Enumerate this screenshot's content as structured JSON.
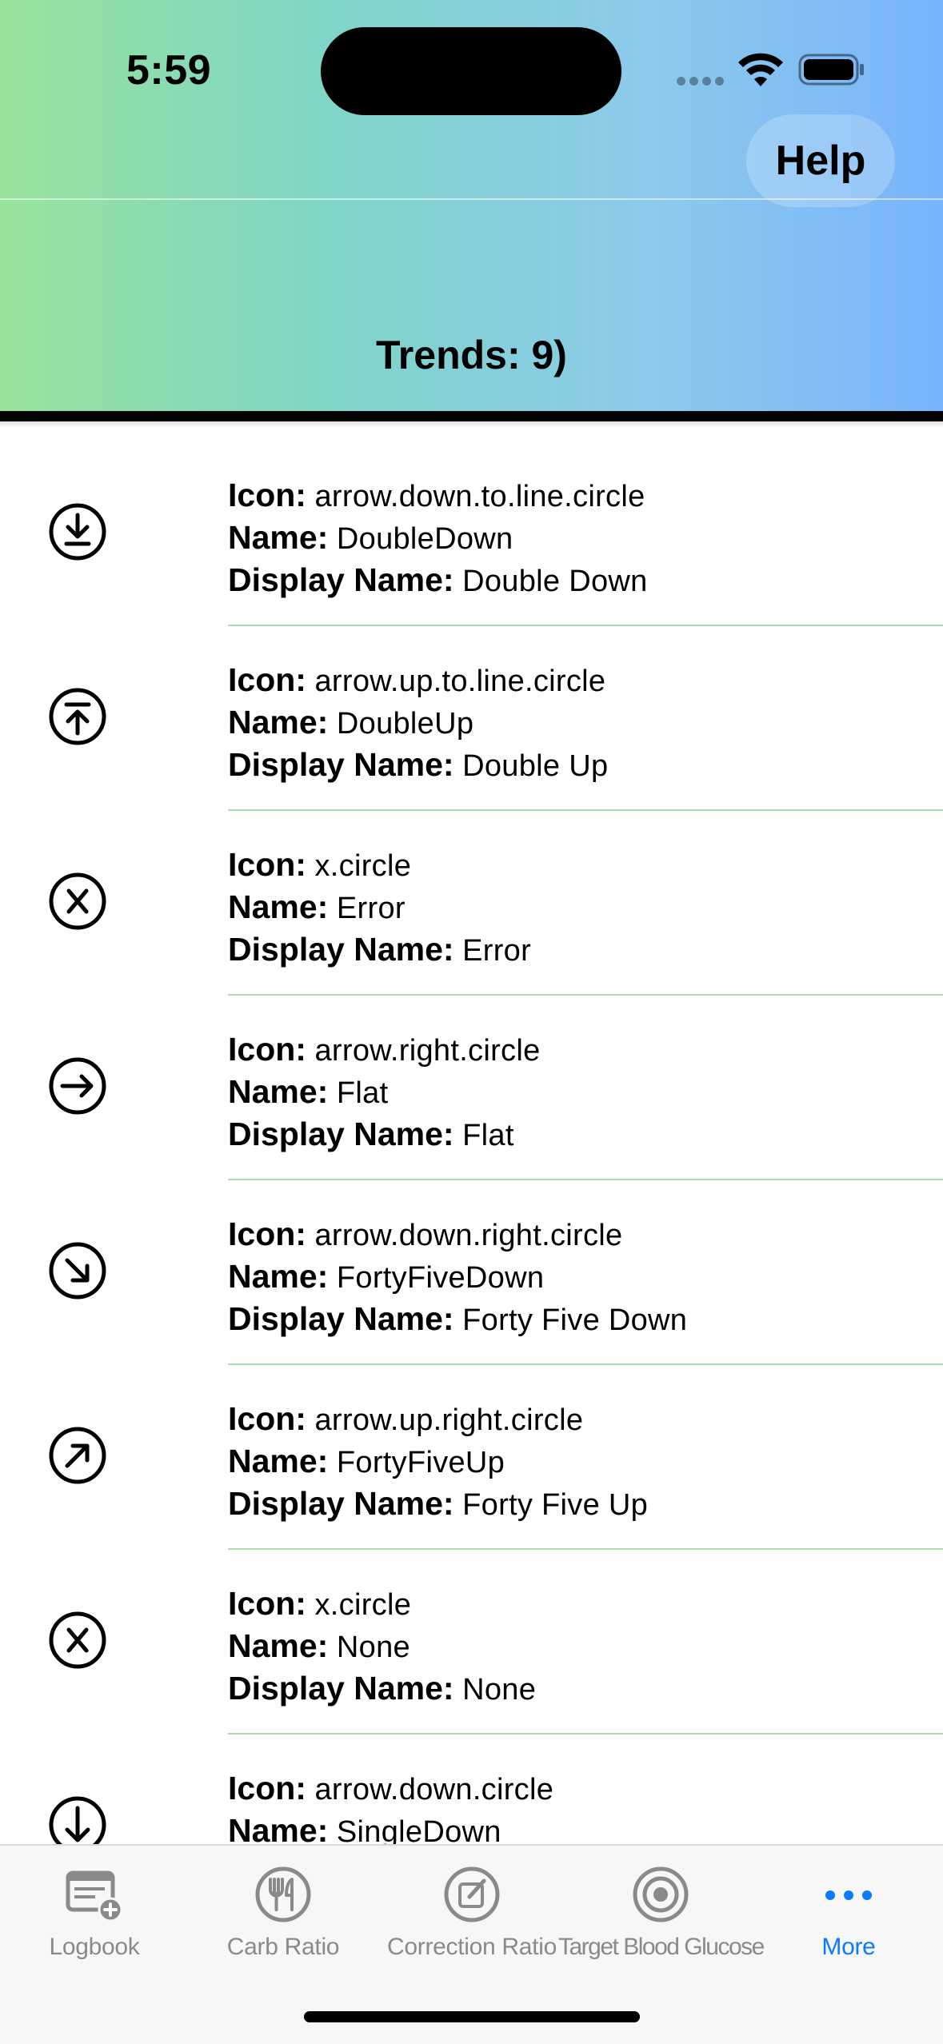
{
  "status": {
    "time": "5:59",
    "icons": [
      "cellular-signal-icon",
      "wifi-icon",
      "battery-icon"
    ]
  },
  "nav": {
    "help_label": "Help",
    "title": "Trends: 9)"
  },
  "labels": {
    "icon": "Icon:",
    "name": "Name:",
    "display_name": "Display Name:"
  },
  "trends": [
    {
      "icon_glyph": "arrow-down-to-line-circle-icon",
      "icon": "arrow.down.to.line.circle",
      "name": "DoubleDown",
      "display_name": "Double Down"
    },
    {
      "icon_glyph": "arrow-up-to-line-circle-icon",
      "icon": "arrow.up.to.line.circle",
      "name": "DoubleUp",
      "display_name": "Double Up"
    },
    {
      "icon_glyph": "x-circle-icon",
      "icon": "x.circle",
      "name": "Error",
      "display_name": "Error"
    },
    {
      "icon_glyph": "arrow-right-circle-icon",
      "icon": "arrow.right.circle",
      "name": "Flat",
      "display_name": "Flat"
    },
    {
      "icon_glyph": "arrow-down-right-circle-icon",
      "icon": "arrow.down.right.circle",
      "name": "FortyFiveDown",
      "display_name": "Forty Five Down"
    },
    {
      "icon_glyph": "arrow-up-right-circle-icon",
      "icon": "arrow.up.right.circle",
      "name": "FortyFiveUp",
      "display_name": "Forty Five Up"
    },
    {
      "icon_glyph": "x-circle-icon",
      "icon": "x.circle",
      "name": "None",
      "display_name": "None"
    },
    {
      "icon_glyph": "arrow-down-circle-icon",
      "icon": "arrow.down.circle",
      "name": "SingleDown",
      "display_name": ""
    }
  ],
  "tabs": [
    {
      "label": "Logbook",
      "icon": "logbook-add-icon",
      "active": false
    },
    {
      "label": "Carb Ratio",
      "icon": "fork-knife-circle-icon",
      "active": false
    },
    {
      "label": "Correction Ratio",
      "icon": "pencil-square-circle-icon",
      "active": false
    },
    {
      "label": "Target Blood Glucose",
      "icon": "target-icon",
      "active": false
    },
    {
      "label": "More",
      "icon": "more-dots-icon",
      "active": true
    }
  ],
  "colors": {
    "gradient_start": "#97e39b",
    "gradient_end": "#78b4fb",
    "divider": "#a6dcb6",
    "tab_active": "#0a7aff",
    "tab_inactive": "#8a8a8a"
  }
}
